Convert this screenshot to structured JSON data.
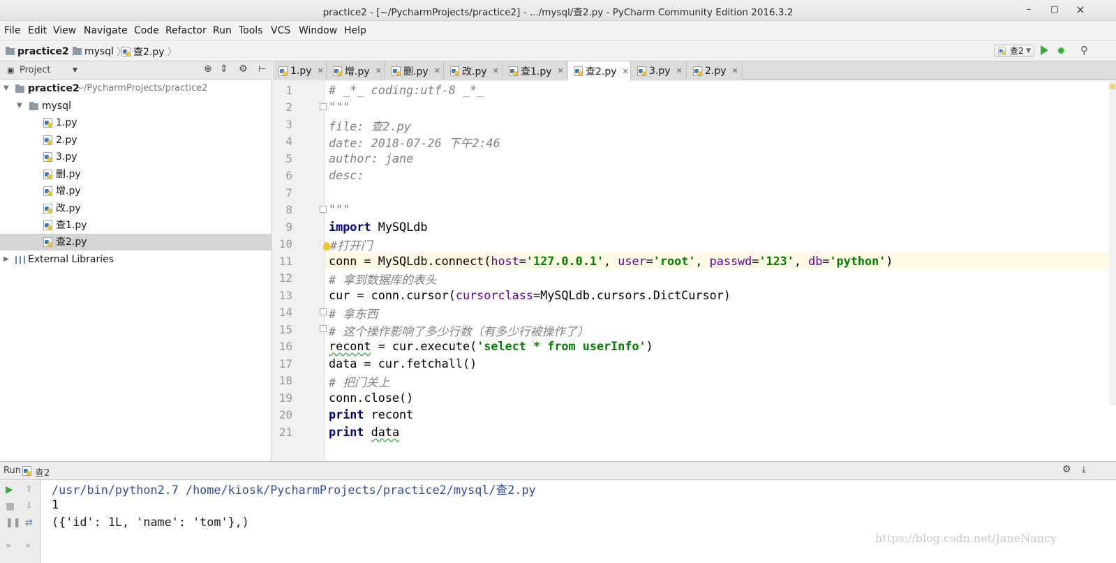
{
  "window": {
    "title": "practice2 - [~/PycharmProjects/practice2] - .../mysql/查2.py - PyCharm Community Edition 2016.3.2",
    "minimize": "–",
    "maximize": "▢",
    "close": "×"
  },
  "menu": [
    "File",
    "Edit",
    "View",
    "Navigate",
    "Code",
    "Refactor",
    "Run",
    "Tools",
    "VCS",
    "Window",
    "Help"
  ],
  "breadcrumb": [
    "practice2",
    "mysql",
    "查2.py"
  ],
  "toolbar": {
    "run_config": "查2"
  },
  "project_panel": {
    "title": "Project",
    "tree": [
      {
        "label": "practice2",
        "sub": "~/PycharmProjects/practice2",
        "level": 0,
        "type": "folder",
        "expanded": true
      },
      {
        "label": "mysql",
        "level": 1,
        "type": "folder",
        "expanded": true
      },
      {
        "label": "1.py",
        "level": 2,
        "type": "file"
      },
      {
        "label": "2.py",
        "level": 2,
        "type": "file"
      },
      {
        "label": "3.py",
        "level": 2,
        "type": "file"
      },
      {
        "label": "删.py",
        "level": 2,
        "type": "file"
      },
      {
        "label": "增.py",
        "level": 2,
        "type": "file"
      },
      {
        "label": "改.py",
        "level": 2,
        "type": "file"
      },
      {
        "label": "查1.py",
        "level": 2,
        "type": "file"
      },
      {
        "label": "查2.py",
        "level": 2,
        "type": "file",
        "selected": true
      },
      {
        "label": "External Libraries",
        "level": 0,
        "type": "libs",
        "expanded": false
      }
    ]
  },
  "tabs": [
    {
      "label": "1.py"
    },
    {
      "label": "增.py"
    },
    {
      "label": "删.py"
    },
    {
      "label": "改.py"
    },
    {
      "label": "查1.py"
    },
    {
      "label": "查2.py",
      "active": true
    },
    {
      "label": "3.py"
    },
    {
      "label": "2.py"
    }
  ],
  "editor": {
    "current_line": 11,
    "line_numbers": [
      "1",
      "2",
      "3",
      "4",
      "5",
      "6",
      "7",
      "8",
      "9",
      "10",
      "11",
      "12",
      "13",
      "14",
      "15",
      "16",
      "17",
      "18",
      "19",
      "20",
      "21"
    ],
    "lines": {
      "l1": "# _*_ coding:utf-8 _*_",
      "l2": "\"\"\"",
      "l3": "file: 查2.py",
      "l4": "date: 2018-07-26 下午2:46",
      "l5": "author: jane",
      "l6": "desc:",
      "l8": "\"\"\"",
      "l9_kw": "import",
      "l9_rest": " MySQLdb",
      "l10": "#打开门",
      "l11_a": "conn = MySQLdb.connect(",
      "l11_p1": "host",
      "l11_s1": "'127.0.0.1'",
      "l11_p2": "user",
      "l11_s2": "'root'",
      "l11_p3": "passwd",
      "l11_s3": "'123'",
      "l11_p4": "db",
      "l11_s4": "'python'",
      "l12": "# 拿到数据库的表头",
      "l13_a": "cur = conn.cursor(",
      "l13_p": "cursorclass",
      "l13_b": "=MySQLdb.cursors.DictCursor)",
      "l14": "# 拿东西",
      "l15": "# 这个操作影响了多少行数（有多少行被操作了）",
      "l16_var": "recont",
      "l16_a": " = cur.execute(",
      "l16_s": "'select * from userInfo'",
      "l17": "data = cur.fetchall()",
      "l18": "# 把门关上",
      "l19": "conn.close()",
      "l20_kw": "print",
      "l20_rest": " recont",
      "l21_kw": "print",
      "l21_var": "data"
    }
  },
  "run_panel": {
    "title": "Run",
    "config": "查2",
    "output": [
      "/usr/bin/python2.7 /home/kiosk/PycharmProjects/practice2/mysql/查2.py",
      "1",
      "({'id': 1L, 'name': 'tom'},)"
    ]
  },
  "watermark": "https://blog.csdn.net/JaneNancy"
}
